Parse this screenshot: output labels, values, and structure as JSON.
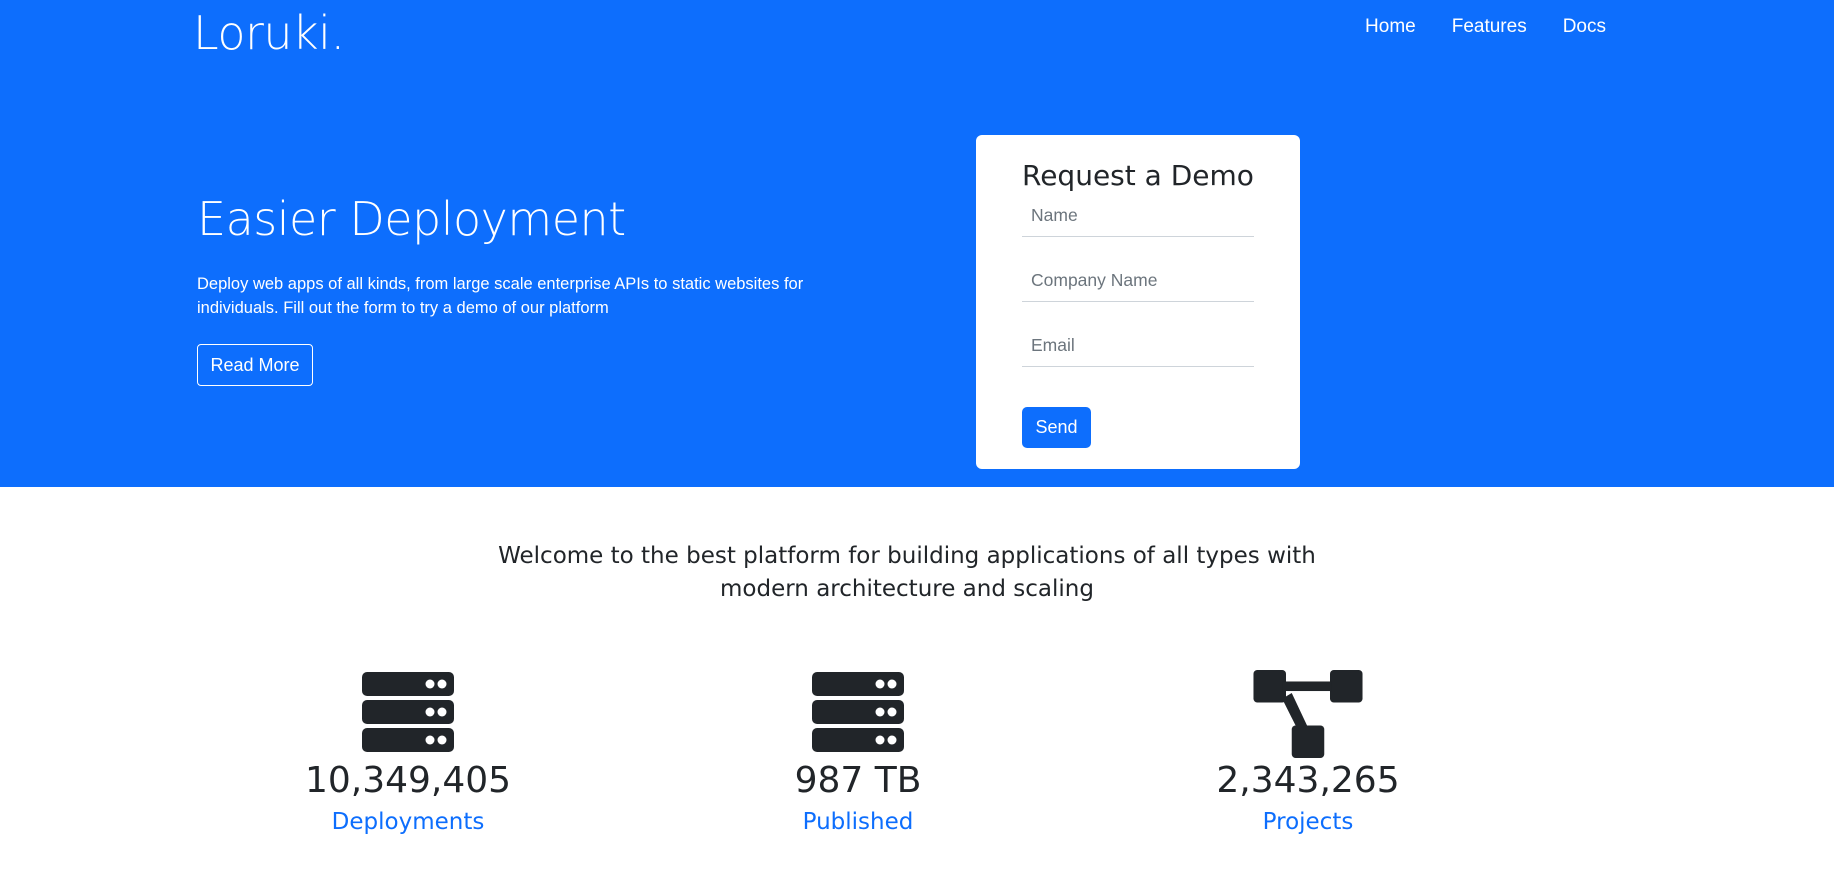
{
  "brand": "Loruki.",
  "nav": {
    "items": [
      "Home",
      "Features",
      "Docs"
    ]
  },
  "hero": {
    "title": "Easier Deployment",
    "text": "Deploy web apps of all kinds, from large scale enterprise APIs to static websites for individuals. Fill out the form to try a demo of our platform",
    "button_label": "Read More"
  },
  "demo_form": {
    "title": "Request a Demo",
    "name_placeholder": "Name",
    "company_placeholder": "Company Name",
    "email_placeholder": "Email",
    "send_label": "Send"
  },
  "welcome": {
    "line1": "Welcome to the best platform for building applications of all types with",
    "line2": "modern architecture and scaling"
  },
  "stats": [
    {
      "icon": "server-icon",
      "value": "10,349,405",
      "label": "Deployments"
    },
    {
      "icon": "server-icon",
      "value": "987 TB",
      "label": "Published"
    },
    {
      "icon": "project-diagram-icon",
      "value": "2,343,265",
      "label": "Projects"
    }
  ],
  "colors": {
    "primary": "#0d6efd",
    "text_dark": "#212529",
    "white": "#ffffff"
  }
}
